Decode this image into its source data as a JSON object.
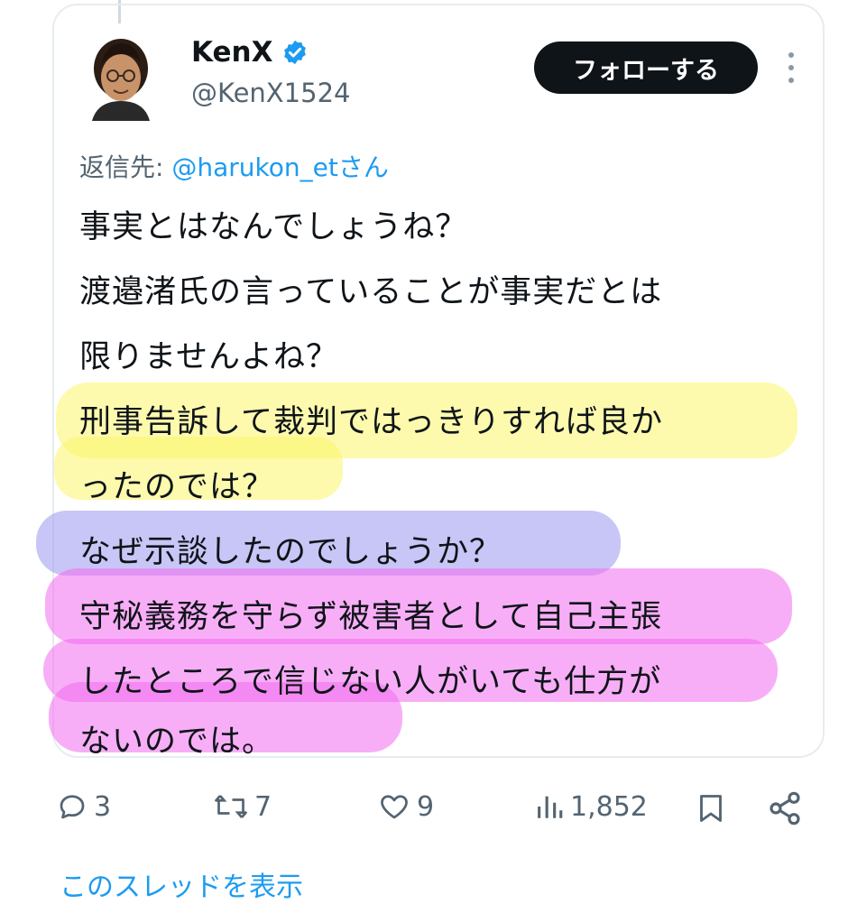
{
  "tweet": {
    "display_name": "KenX",
    "handle": "@KenX1524",
    "follow_label": "フォローする",
    "reply_prefix": "返信先: ",
    "reply_mention": "@harukon_et",
    "reply_suffix": "さん",
    "lines": [
      "事実とはなんでしょうね？",
      "渡邉渚氏の言っていることが事実だとは",
      "限りませんよね？",
      "刑事告訴して裁判ではっきりすれば良か",
      "ったのでは？",
      "なぜ示談したのでしょうか？",
      "守秘義務を守らず被害者として自己主張",
      "したところで信じない人がいても仕方が",
      "ないのでは。"
    ]
  },
  "stats": {
    "replies": "3",
    "reposts": "7",
    "likes": "9",
    "views": "1,852"
  },
  "footer": {
    "show_thread": "このスレッドを表示"
  },
  "colors": {
    "accent": "#1d9bf0",
    "highlight_yellow": "#fbf66a",
    "highlight_blue": "#9a98ee",
    "highlight_pink": "#f36cf0",
    "text_secondary": "#536471"
  },
  "icons": {
    "verified": "verified-badge-icon",
    "reply": "reply-icon",
    "repost": "repost-icon",
    "like": "heart-icon",
    "views": "views-icon",
    "bookmark": "bookmark-icon",
    "share": "share-icon",
    "more": "more-icon"
  }
}
